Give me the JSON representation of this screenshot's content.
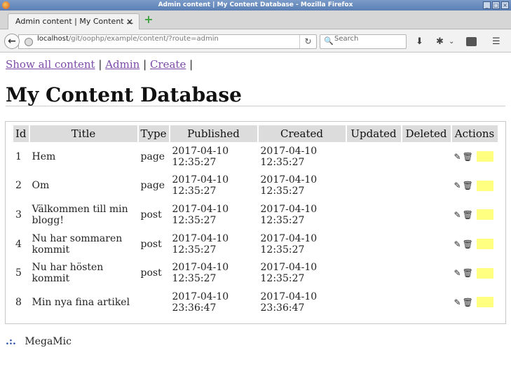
{
  "window": {
    "title": "Admin content | My Content Database - Mozilla Firefox"
  },
  "tab": {
    "label": "Admin content | My Content ...",
    "close": "×",
    "new": "+"
  },
  "nav": {
    "url_host": "localhost",
    "url_path": "/git/oophp/example/content/?route=admin",
    "search_placeholder": "Search"
  },
  "page": {
    "links": [
      "Show all content",
      "Admin",
      "Create"
    ],
    "separator": "|",
    "heading": "My Content Database",
    "footer_brand": "MegaMic",
    "footer_dots": ".:."
  },
  "table": {
    "headers": [
      "Id",
      "Title",
      "Type",
      "Published",
      "Created",
      "Updated",
      "Deleted",
      "Actions"
    ],
    "rows": [
      {
        "id": "1",
        "title": "Hem",
        "type": "page",
        "published": "2017-04-10 12:35:27",
        "created": "2017-04-10 12:35:27",
        "updated": "",
        "deleted": ""
      },
      {
        "id": "2",
        "title": "Om",
        "type": "page",
        "published": "2017-04-10 12:35:27",
        "created": "2017-04-10 12:35:27",
        "updated": "",
        "deleted": ""
      },
      {
        "id": "3",
        "title": "Välkommen till min blogg!",
        "type": "post",
        "published": "2017-04-10 12:35:27",
        "created": "2017-04-10 12:35:27",
        "updated": "",
        "deleted": ""
      },
      {
        "id": "4",
        "title": "Nu har sommaren kommit",
        "type": "post",
        "published": "2017-04-10 12:35:27",
        "created": "2017-04-10 12:35:27",
        "updated": "",
        "deleted": ""
      },
      {
        "id": "5",
        "title": "Nu har hösten kommit",
        "type": "post",
        "published": "2017-04-10 12:35:27",
        "created": "2017-04-10 12:35:27",
        "updated": "",
        "deleted": ""
      },
      {
        "id": "8",
        "title": "Min nya fina artikel",
        "type": "",
        "published": "2017-04-10 23:36:47",
        "created": "2017-04-10 23:36:47",
        "updated": "",
        "deleted": ""
      }
    ]
  },
  "icons": {
    "edit": "edit-icon",
    "delete": "trash-icon"
  },
  "colors": {
    "link": "#7c4ba8",
    "highlight": "#ffff80",
    "header_bg": "#dcdcdc"
  }
}
